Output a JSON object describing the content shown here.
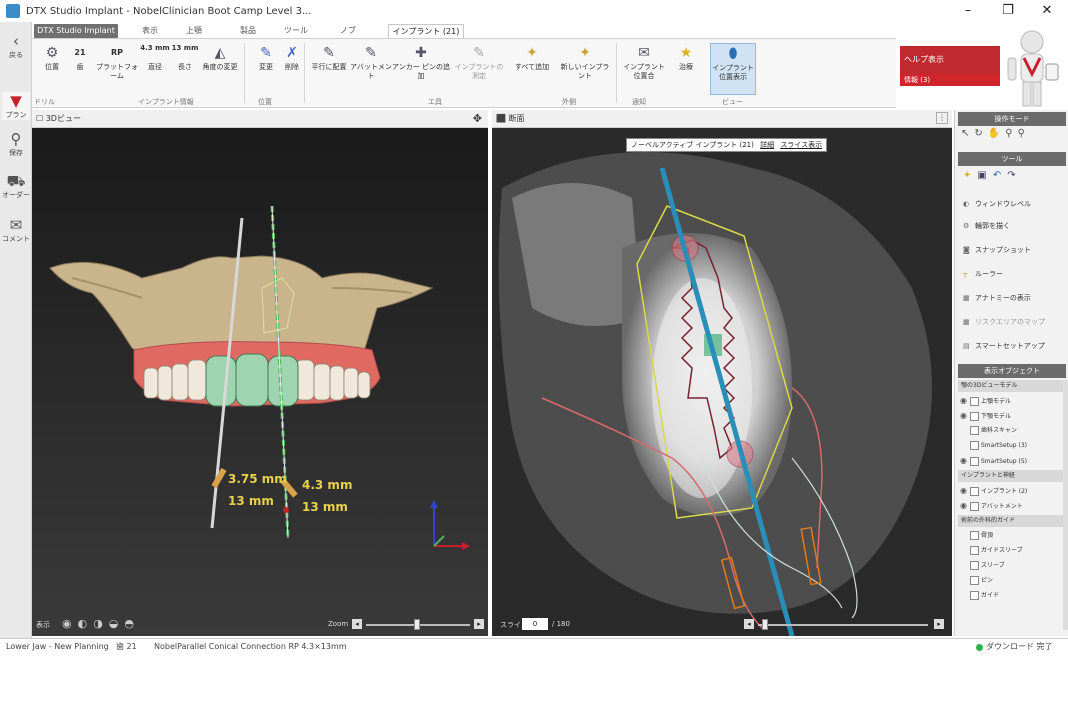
{
  "window": {
    "title": "DTX Studio Implant - NobelClinician Boot Camp Level 3...",
    "minimize": "–",
    "maximize": "❐",
    "close": "✕"
  },
  "leftbar": {
    "items": [
      {
        "label": "戻る",
        "icon": "back-arrow-icon"
      },
      {
        "label": "プラン",
        "icon": "implant-icon"
      },
      {
        "label": "保存",
        "icon": "person-icon"
      },
      {
        "label": "オーダー",
        "icon": "cart-icon"
      },
      {
        "label": "コメント",
        "icon": "chat-icon"
      }
    ]
  },
  "ribbon": {
    "file_tab": "DTX Studio Implant ▾",
    "tabs": [
      "表示",
      "上顎",
      "製品",
      "ツール",
      "ノブ",
      "インプラント (21)"
    ],
    "buttons": [
      {
        "top": "",
        "label": "位置",
        "icon": "gear-icon"
      },
      {
        "top": "21",
        "label": "歯",
        "icon": "tooth-number"
      },
      {
        "top": "RP",
        "label": "プラットフォーム",
        "icon": "platform-label"
      },
      {
        "top": "4.3 mm",
        "label": "直径",
        "icon": "diameter"
      },
      {
        "top": "13 mm",
        "label": "長さ",
        "icon": "length"
      },
      {
        "top": "",
        "label": "角度の変更",
        "icon": "angle-icon"
      },
      {
        "top": "",
        "label": "変更",
        "icon": "edit-icon"
      },
      {
        "top": "",
        "label": "削除",
        "icon": "delete-icon"
      },
      {
        "top": "",
        "label": "平行に配置",
        "icon": "parallel-icon"
      },
      {
        "top": "",
        "label": "アバットメント",
        "icon": "abutment-icon"
      },
      {
        "top": "",
        "label": "アンカー ピンの追加",
        "icon": "anchor-pin-icon"
      },
      {
        "top": "",
        "label": "インプラントの測定",
        "icon": "measure-icon"
      },
      {
        "top": "",
        "label": "すべて追加",
        "icon": "add-all-icon"
      },
      {
        "top": "",
        "label": "新しいインプラント",
        "icon": "new-implant-icon"
      },
      {
        "top": "",
        "label": "インプラント 位置合",
        "icon": "align-icon"
      },
      {
        "top": "",
        "label": "治療",
        "icon": "star-icon"
      },
      {
        "top": "",
        "label": "インプラント 位置表示",
        "icon": "show-implant-icon"
      }
    ],
    "groups": [
      "ドリル",
      "インプラント情報",
      "位置",
      "エ具",
      "外側",
      "通知",
      "ビュー"
    ]
  },
  "help_panel": {
    "title": "ヘルプ表示",
    "notice": "情報 (3)"
  },
  "view3d": {
    "header": "3Dビュー",
    "measurements": [
      {
        "value": "3.75 mm"
      },
      {
        "value": "13 mm"
      },
      {
        "value": "4.3 mm"
      },
      {
        "value": "13 mm"
      }
    ],
    "footer_label": "表示",
    "zoom_label": "Zoom"
  },
  "viewct": {
    "header": "断面",
    "implant_label": "ノーベルアクティブ インプラント (21)",
    "link1": "詳細",
    "link2": "スライス表示",
    "slice_label": "スライス",
    "slice_value": "0",
    "slice_total": "/ 180"
  },
  "right_panel": {
    "tool_header": "操作モード",
    "tools_header": "ツール",
    "tool_items": [
      {
        "label": "ウィンドウレベル",
        "icon": "window-level-icon"
      },
      {
        "label": "輪郭を描く",
        "icon": "contour-icon"
      },
      {
        "label": "スナップショット",
        "icon": "camera-icon"
      },
      {
        "label": "ルーラー",
        "icon": "ruler-icon"
      },
      {
        "label": "アナトミーの表示",
        "icon": "anatomy-icon"
      },
      {
        "label": "リスクエリアのマップ",
        "icon": "risk-icon"
      },
      {
        "label": "スマートセットアップ",
        "icon": "setup-icon"
      }
    ],
    "objects_header": "表示オブジェクト",
    "groups": [
      {
        "title": "顎の3Dビューモデル",
        "rows": [
          {
            "label": "上顎モデル",
            "icon": "jaw-icon"
          },
          {
            "label": "下顎モデル",
            "icon": "jaw-icon"
          },
          {
            "label": "歯科スキャン",
            "icon": "scan-icon"
          },
          {
            "label": "SmartSetup (3)",
            "icon": "scan-icon"
          },
          {
            "label": "SmartSetup (5)",
            "icon": "scan-icon"
          }
        ]
      },
      {
        "title": "インプラントと神経",
        "rows": [
          {
            "label": "インプラント (2)",
            "icon": "implant-row-icon"
          },
          {
            "label": "アバットメント",
            "icon": "abutment-row-icon"
          }
        ]
      },
      {
        "title": "術前の外科的ガイド",
        "rows": [
          {
            "label": "骨頂",
            "icon": "bone-icon"
          },
          {
            "label": "ガイドスリーブ",
            "icon": "sleeve-icon"
          },
          {
            "label": "スリーブ",
            "icon": "sleeve-icon"
          },
          {
            "label": "ピン",
            "icon": "pin-icon"
          },
          {
            "label": "ガイド",
            "icon": "guide-icon"
          }
        ]
      }
    ]
  },
  "status": {
    "left": "Lower Jaw - New Planning",
    "mid": "歯 21",
    "implant": "NobelParallel Conical Connection RP 4.3×13mm",
    "right": "ダウンロード 完了"
  },
  "colors": {
    "accent_red": "#c8202b",
    "implant_blue": "#2a8fb8",
    "guide_yellow": "#d8d84a",
    "nerve_red": "#c8505a"
  }
}
